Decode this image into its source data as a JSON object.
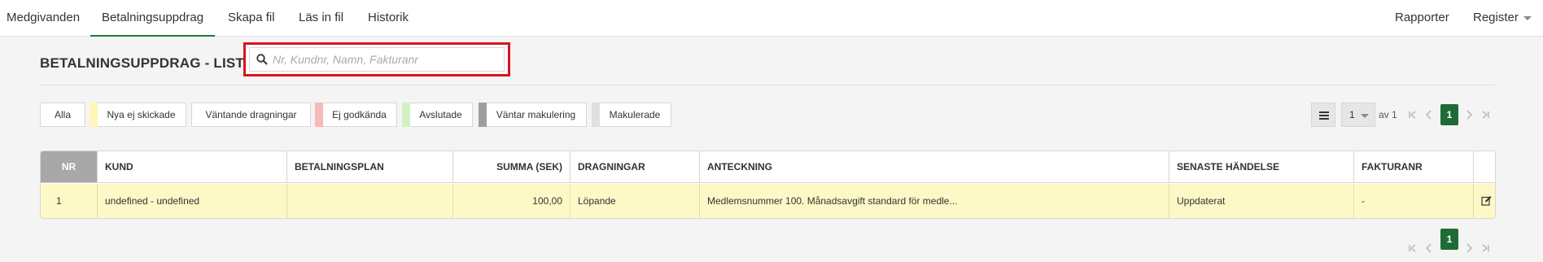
{
  "nav": {
    "tabs": [
      "Medgivanden",
      "Betalningsuppdrag",
      "Skapa fil",
      "Läs in fil",
      "Historik"
    ],
    "active_tab": "Betalningsuppdrag",
    "reports": "Rapporter",
    "register": "Register"
  },
  "page": {
    "title": "BETALNINGSUPPDRAG - LISTA",
    "search_value": "",
    "search_placeholder": "Nr, Kundnr, Namn, Fakturanr"
  },
  "filters": [
    {
      "label": "Alla",
      "color": ""
    },
    {
      "label": "Nya ej skickade",
      "color": "#fdf7b7"
    },
    {
      "label": "Väntande dragningar",
      "color": ""
    },
    {
      "label": "Ej godkända",
      "color": "#f7b9b9"
    },
    {
      "label": "Avslutade",
      "color": "#d2f0c4"
    },
    {
      "label": "Väntar makulering",
      "color": "#9e9e9e"
    },
    {
      "label": "Makulerade",
      "color": "#e0e0e0"
    }
  ],
  "pager": {
    "page_select": "1",
    "of_label": "av 1",
    "current_page": "1"
  },
  "table": {
    "columns": [
      "NR",
      "KUND",
      "BETALNINGSPLAN",
      "SUMMA (SEK)",
      "DRAGNINGAR",
      "ANTECKNING",
      "SENASTE HÄNDELSE",
      "FAKTURANR"
    ],
    "rows": [
      {
        "nr": "1",
        "kund": "undefined - undefined",
        "betalningsplan": "",
        "summa": "100,00",
        "dragningar": "Löpande",
        "anteckning": "Medlemsnummer 100. Månadsavgift standard för medle...",
        "senaste_handelse": "Uppdaterat",
        "fakturanr": "-"
      }
    ]
  },
  "colors": {
    "accent": "#1e6b36",
    "row_highlight": "#fdf9c7",
    "search_highlight": "#d9141b"
  }
}
